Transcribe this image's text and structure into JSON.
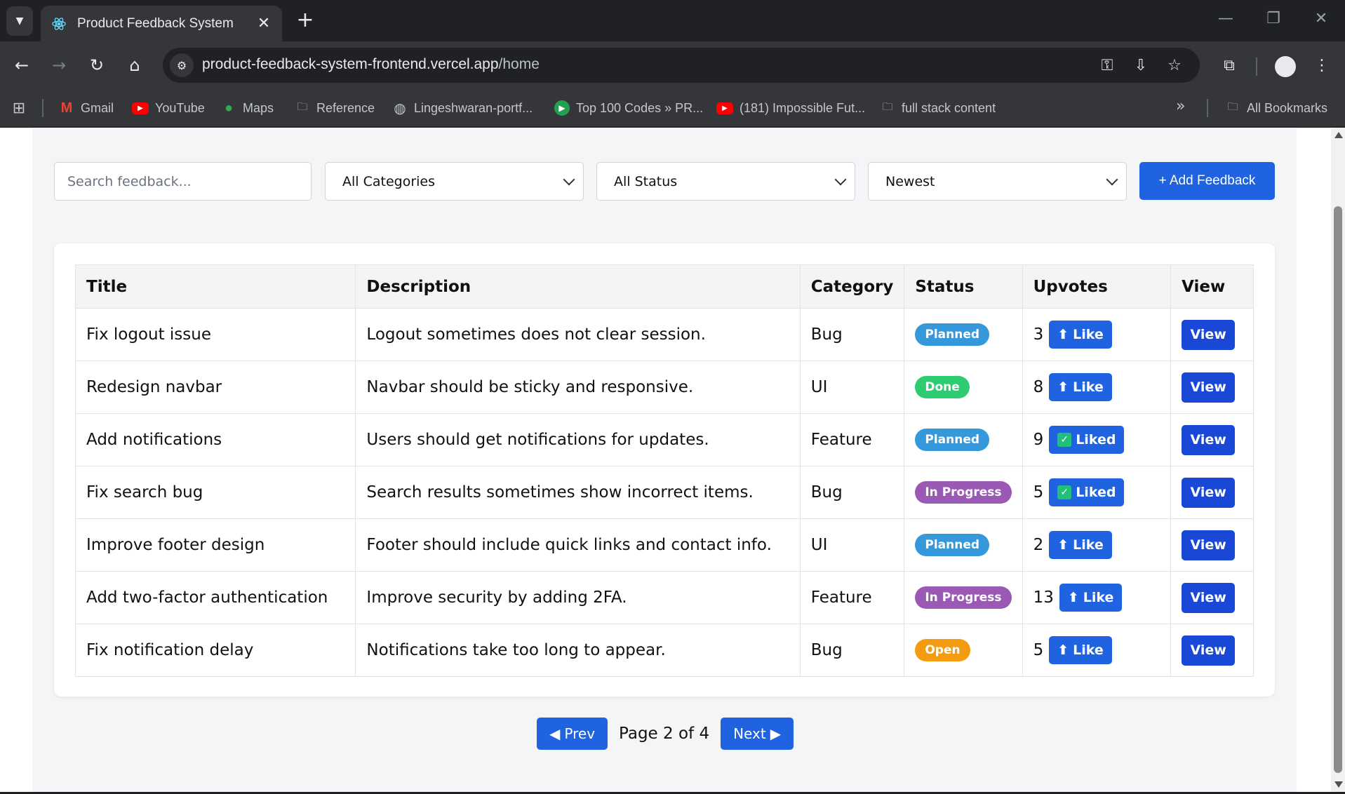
{
  "browser": {
    "tab_title": "Product Feedback System",
    "url_host": "product-feedback-system-frontend.vercel.app",
    "url_path": "/home",
    "bookmarks": [
      {
        "label": "Gmail",
        "icon": "gmail-icon"
      },
      {
        "label": "YouTube",
        "icon": "youtube-icon"
      },
      {
        "label": "Maps",
        "icon": "maps-icon"
      },
      {
        "label": "Reference",
        "icon": "folder-icon"
      },
      {
        "label": "Lingeshwaran-portf...",
        "icon": "globe-icon"
      },
      {
        "label": "Top 100 Codes » PR...",
        "icon": "site-icon"
      },
      {
        "label": "(181) Impossible Fut...",
        "icon": "youtube-icon"
      },
      {
        "label": "full stack content",
        "icon": "folder-icon"
      }
    ],
    "all_bookmarks": "All Bookmarks"
  },
  "filters": {
    "search_placeholder": "Search feedback...",
    "category": "All Categories",
    "status": "All Status",
    "sort": "Newest",
    "add_button": "+ Add Feedback"
  },
  "table": {
    "headers": [
      "Title",
      "Description",
      "Category",
      "Status",
      "Upvotes",
      "View"
    ],
    "rows": [
      {
        "title": "Fix logout issue",
        "description": "Logout sometimes does not clear session.",
        "category": "Bug",
        "status": "Planned",
        "upvotes": "3",
        "like": "Like",
        "liked": false,
        "view": "View"
      },
      {
        "title": "Redesign navbar",
        "description": "Navbar should be sticky and responsive.",
        "category": "UI",
        "status": "Done",
        "upvotes": "8",
        "like": "Like",
        "liked": false,
        "view": "View"
      },
      {
        "title": "Add notifications",
        "description": "Users should get notifications for updates.",
        "category": "Feature",
        "status": "Planned",
        "upvotes": "9",
        "like": "Liked",
        "liked": true,
        "view": "View"
      },
      {
        "title": "Fix search bug",
        "description": "Search results sometimes show incorrect items.",
        "category": "Bug",
        "status": "In Progress",
        "upvotes": "5",
        "like": "Liked",
        "liked": true,
        "view": "View"
      },
      {
        "title": "Improve footer design",
        "description": "Footer should include quick links and contact info.",
        "category": "UI",
        "status": "Planned",
        "upvotes": "2",
        "like": "Like",
        "liked": false,
        "view": "View"
      },
      {
        "title": "Add two-factor authentication",
        "description": "Improve security by adding 2FA.",
        "category": "Feature",
        "status": "In Progress",
        "upvotes": "13",
        "like": "Like",
        "liked": false,
        "view": "View"
      },
      {
        "title": "Fix notification delay",
        "description": "Notifications take too long to appear.",
        "category": "Bug",
        "status": "Open",
        "upvotes": "5",
        "like": "Like",
        "liked": false,
        "view": "View"
      }
    ]
  },
  "status_colors": {
    "Planned": "#3498db",
    "Done": "#2ecc71",
    "In Progress": "#9b59b6",
    "Open": "#f39c12"
  },
  "pagination": {
    "prev": "Prev",
    "page_text": "Page 2 of 4",
    "next": "Next"
  }
}
